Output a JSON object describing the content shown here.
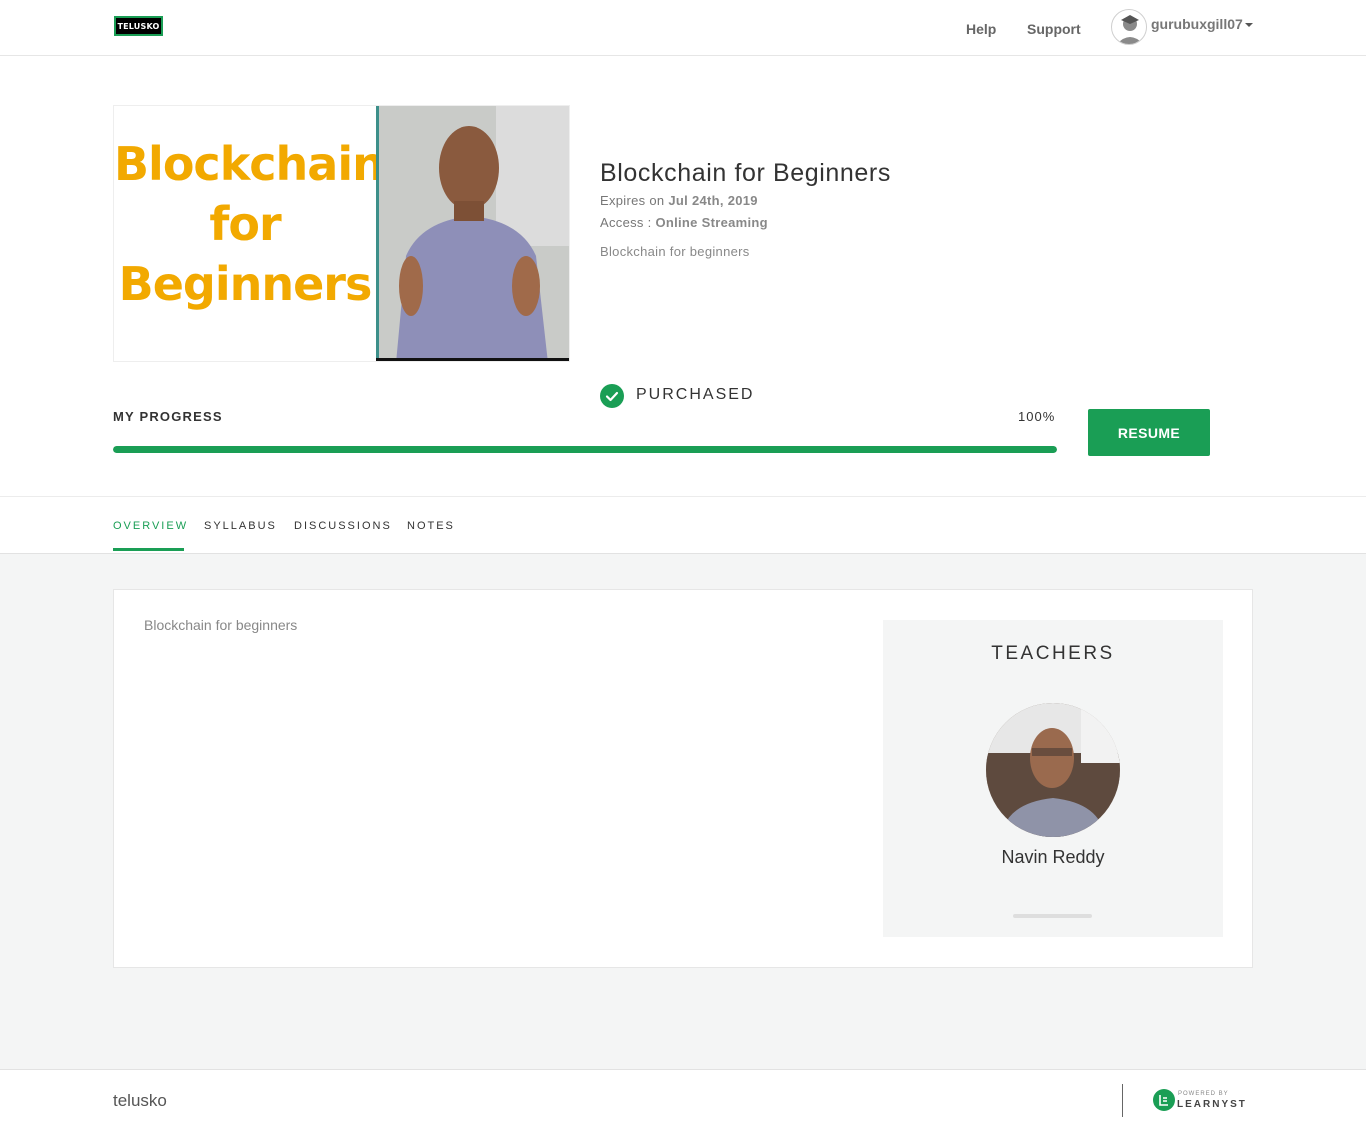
{
  "header": {
    "logo_text": "TELUSKO",
    "nav": [
      {
        "label": "Help"
      },
      {
        "label": "Support"
      }
    ],
    "user": {
      "username": "gurubuxgill07"
    }
  },
  "course": {
    "thumbnail_text": [
      "Blockchain",
      "for",
      "Beginners"
    ],
    "title": "Blockchain for Beginners",
    "expires_prefix": "Expires on",
    "expires_date": "Jul 24th, 2019",
    "access_prefix": "Access :",
    "access_value": "Online Streaming",
    "short_description": "Blockchain for beginners",
    "status": "PURCHASED"
  },
  "progress": {
    "label": "MY PROGRESS",
    "value_text": "100%",
    "fraction": 1.0
  },
  "resume_button": {
    "label": "RESUME"
  },
  "tabs": [
    {
      "label": "OVERVIEW",
      "active": true
    },
    {
      "label": "SYLLABUS",
      "active": false
    },
    {
      "label": "DISCUSSIONS",
      "active": false
    },
    {
      "label": "NOTES",
      "active": false
    }
  ],
  "overview": {
    "description": "Blockchain for beginners",
    "teachers_heading": "TEACHERS",
    "teachers": [
      {
        "name": "Navin Reddy"
      }
    ]
  },
  "footer": {
    "brand": "telusko",
    "powered_by": "POWERED BY",
    "platform": "LEARNYST"
  },
  "colors": {
    "accent": "#1a9e55",
    "thumbnail_text": "#f2a900",
    "page_background": "#f4f5f5"
  }
}
